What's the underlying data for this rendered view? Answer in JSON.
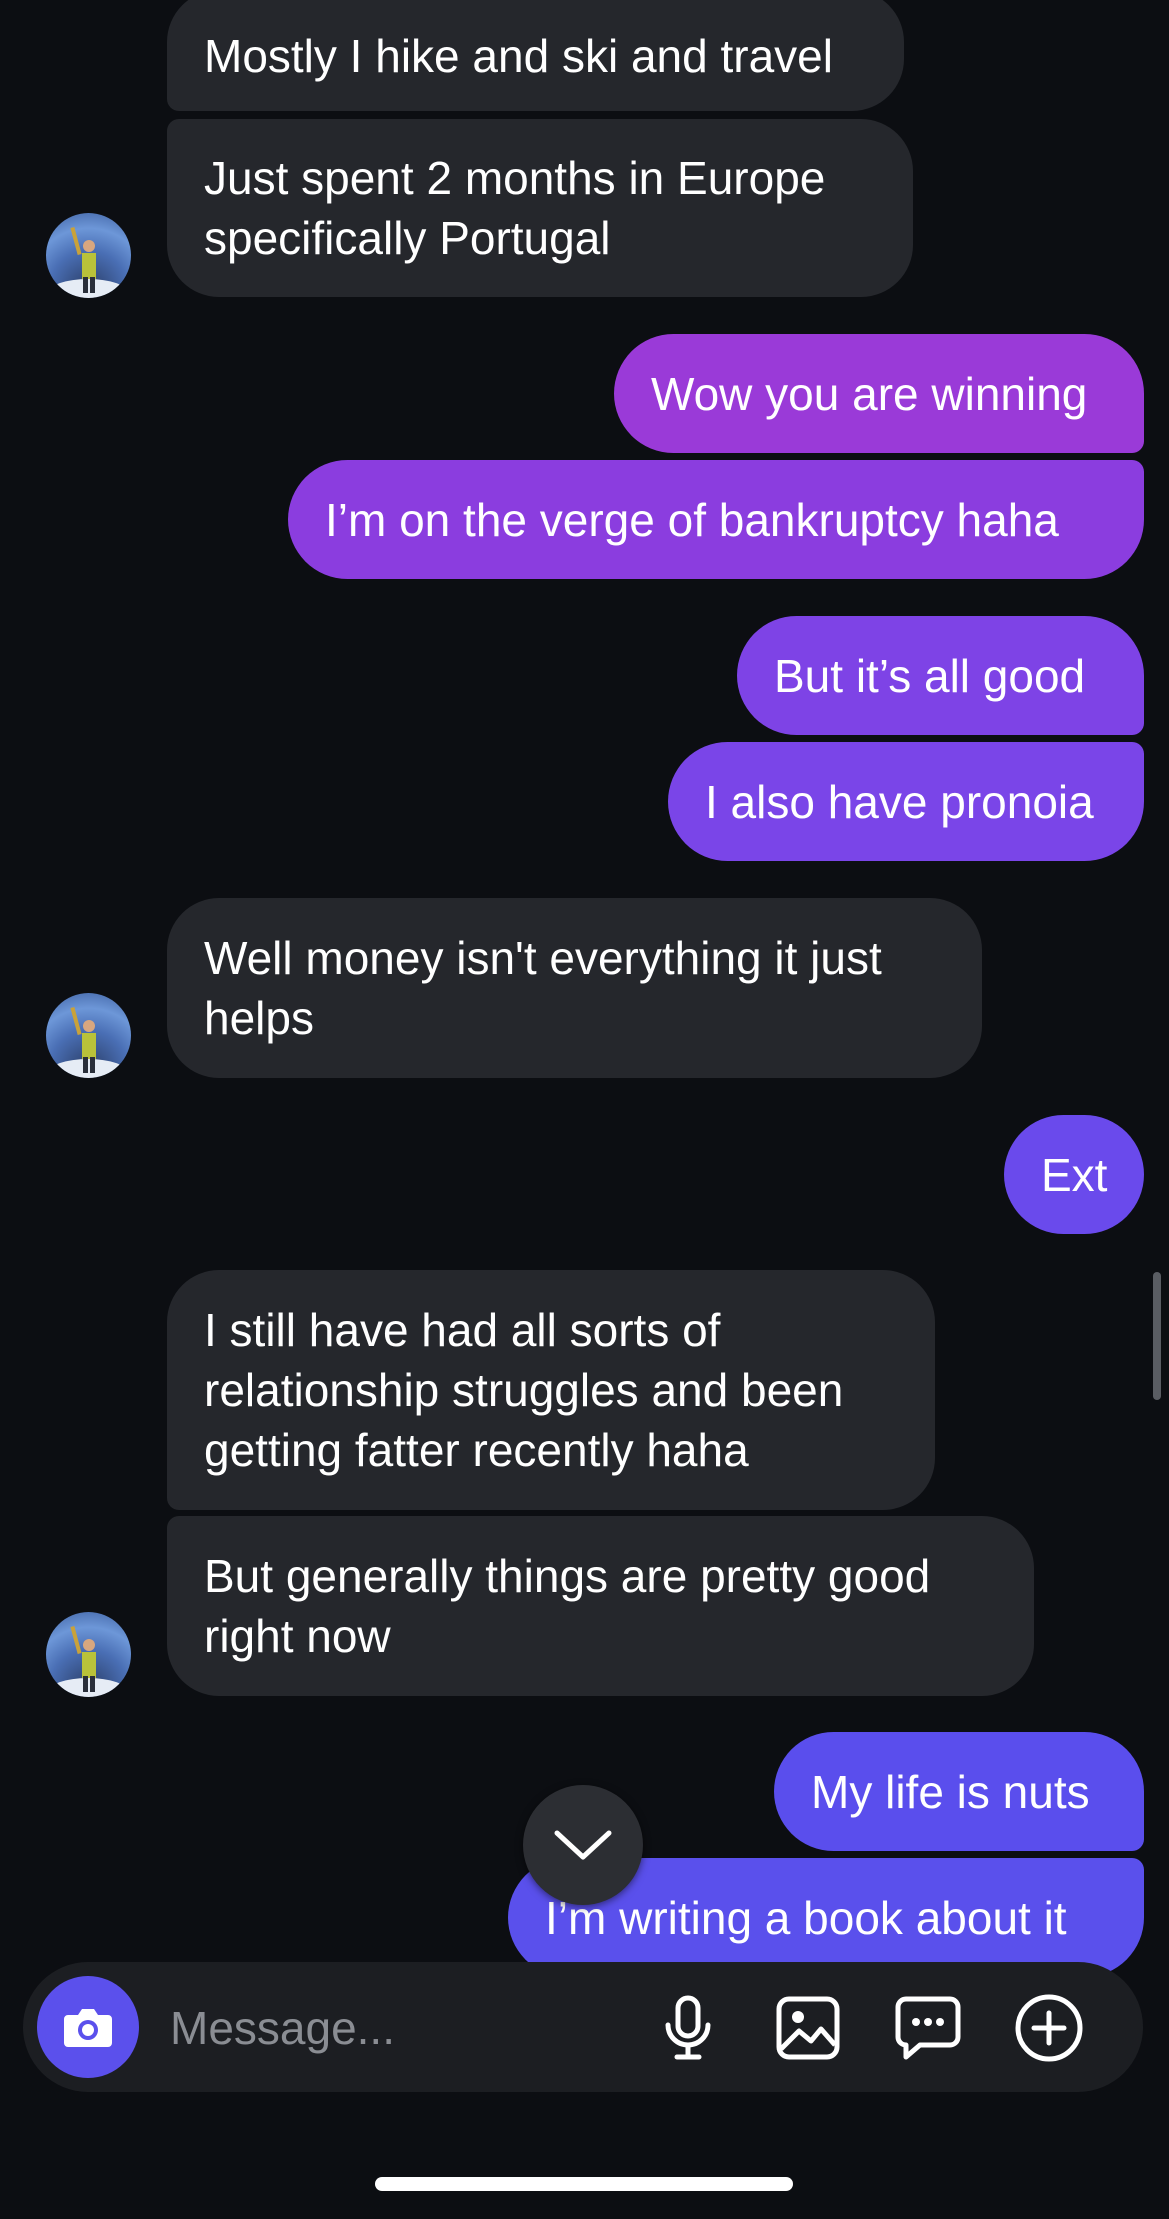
{
  "messages": [
    {
      "from": "them",
      "text": "Mostly I hike and ski and travel"
    },
    {
      "from": "them",
      "text": "Just spent 2 months in Europe specifically Portugal"
    },
    {
      "from": "me",
      "text": "Wow you are winning"
    },
    {
      "from": "me",
      "text": "I’m on the verge of bankruptcy haha"
    },
    {
      "from": "me",
      "text": "But it’s all good"
    },
    {
      "from": "me",
      "text": "I also have pronoia"
    },
    {
      "from": "them",
      "text": "Well money isn't everything it just helps"
    },
    {
      "from": "me",
      "text": "Ext"
    },
    {
      "from": "them",
      "text": "I still have had all sorts of relationship struggles and been getting fatter recently haha"
    },
    {
      "from": "them",
      "text": "But generally things are pretty good right now"
    },
    {
      "from": "me",
      "text": "My life is nuts"
    },
    {
      "from": "me",
      "text": "I’m writing a book about it"
    }
  ],
  "colors": {
    "background": "#0c0e12",
    "incoming_bubble": "#25272c",
    "outgoing_gradient": [
      "#9a3ad8",
      "#8b3ddf",
      "#7e43e6",
      "#6a4aec",
      "#5a4eed",
      "#5a50ec"
    ],
    "accent": "#5b50ec"
  },
  "composer": {
    "placeholder": "Message...",
    "icons": [
      "camera-icon",
      "microphone-icon",
      "image-icon",
      "sticker-chat-icon",
      "add-icon"
    ]
  },
  "scroll_down_icon": "chevron-down-icon"
}
